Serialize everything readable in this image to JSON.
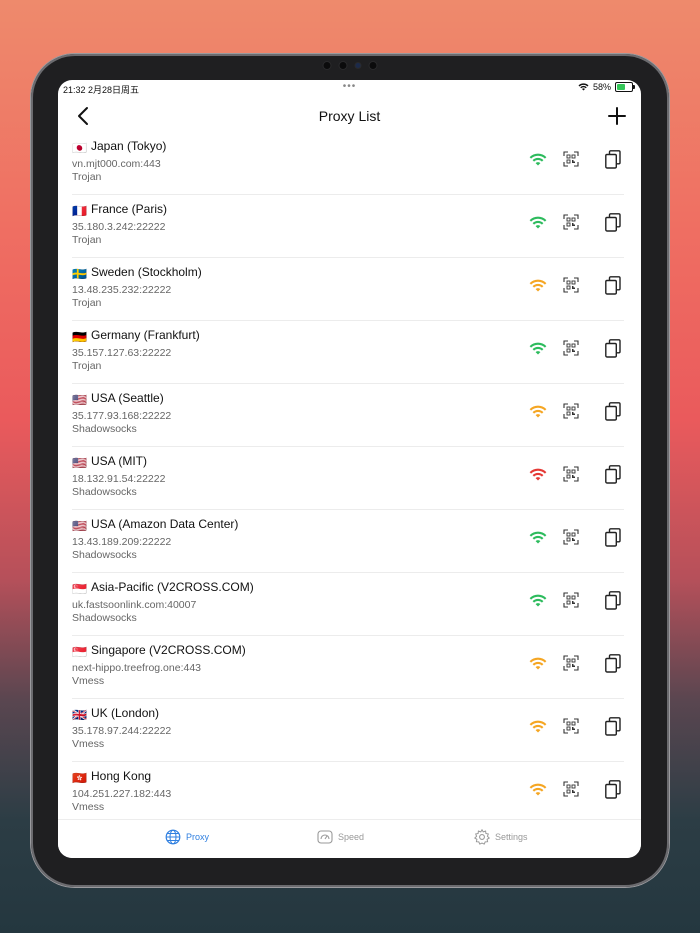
{
  "status_bar": {
    "time": "21:32  2月28日周五",
    "dots": "•••",
    "battery": "58%",
    "battery_level": 0.58
  },
  "nav": {
    "title": "Proxy List",
    "back_icon": "chevron-left-icon",
    "add_icon": "plus-icon"
  },
  "colors": {
    "good": "#2dbb5d",
    "medium": "#f5a623",
    "poor": "#e53935",
    "accent": "#2f7fe0"
  },
  "proxies": [
    {
      "flag": "🇯🇵",
      "name": "Japan (Tokyo)",
      "address": "vn.mjt000.com:443",
      "protocol": "Trojan",
      "signal": "good"
    },
    {
      "flag": "🇫🇷",
      "name": "France (Paris)",
      "address": "35.180.3.242:22222",
      "protocol": "Trojan",
      "signal": "good"
    },
    {
      "flag": "🇸🇪",
      "name": "Sweden (Stockholm)",
      "address": "13.48.235.232:22222",
      "protocol": "Trojan",
      "signal": "medium"
    },
    {
      "flag": "🇩🇪",
      "name": "Germany (Frankfurt)",
      "address": "35.157.127.63:22222",
      "protocol": "Trojan",
      "signal": "good"
    },
    {
      "flag": "🇺🇸",
      "name": "USA (Seattle)",
      "address": "35.177.93.168:22222",
      "protocol": "Shadowsocks",
      "signal": "medium"
    },
    {
      "flag": "🇺🇸",
      "name": "USA (MIT)",
      "address": "18.132.91.54:22222",
      "protocol": "Shadowsocks",
      "signal": "poor"
    },
    {
      "flag": "🇺🇸",
      "name": "USA (Amazon Data Center)",
      "address": "13.43.189.209:22222",
      "protocol": "Shadowsocks",
      "signal": "good"
    },
    {
      "flag": "🇸🇬",
      "name": "Asia-Pacific (V2CROSS.COM)",
      "address": "uk.fastsoonlink.com:40007",
      "protocol": "Shadowsocks",
      "signal": "good"
    },
    {
      "flag": "🇸🇬",
      "name": "Singapore (V2CROSS.COM)",
      "address": "next-hippo.treefrog.one:443",
      "protocol": "Vmess",
      "signal": "medium"
    },
    {
      "flag": "🇬🇧",
      "name": "UK (London)",
      "address": "35.178.97.244:22222",
      "protocol": "Vmess",
      "signal": "medium"
    },
    {
      "flag": "🇭🇰",
      "name": "Hong Kong",
      "address": "104.251.227.182:443",
      "protocol": "Vmess",
      "signal": "medium"
    }
  ],
  "tabs": [
    {
      "label": "Proxy",
      "icon": "globe-icon",
      "active": true
    },
    {
      "label": "Speed",
      "icon": "speedometer-icon",
      "active": false
    },
    {
      "label": "Settings",
      "icon": "gear-icon",
      "active": false
    }
  ]
}
